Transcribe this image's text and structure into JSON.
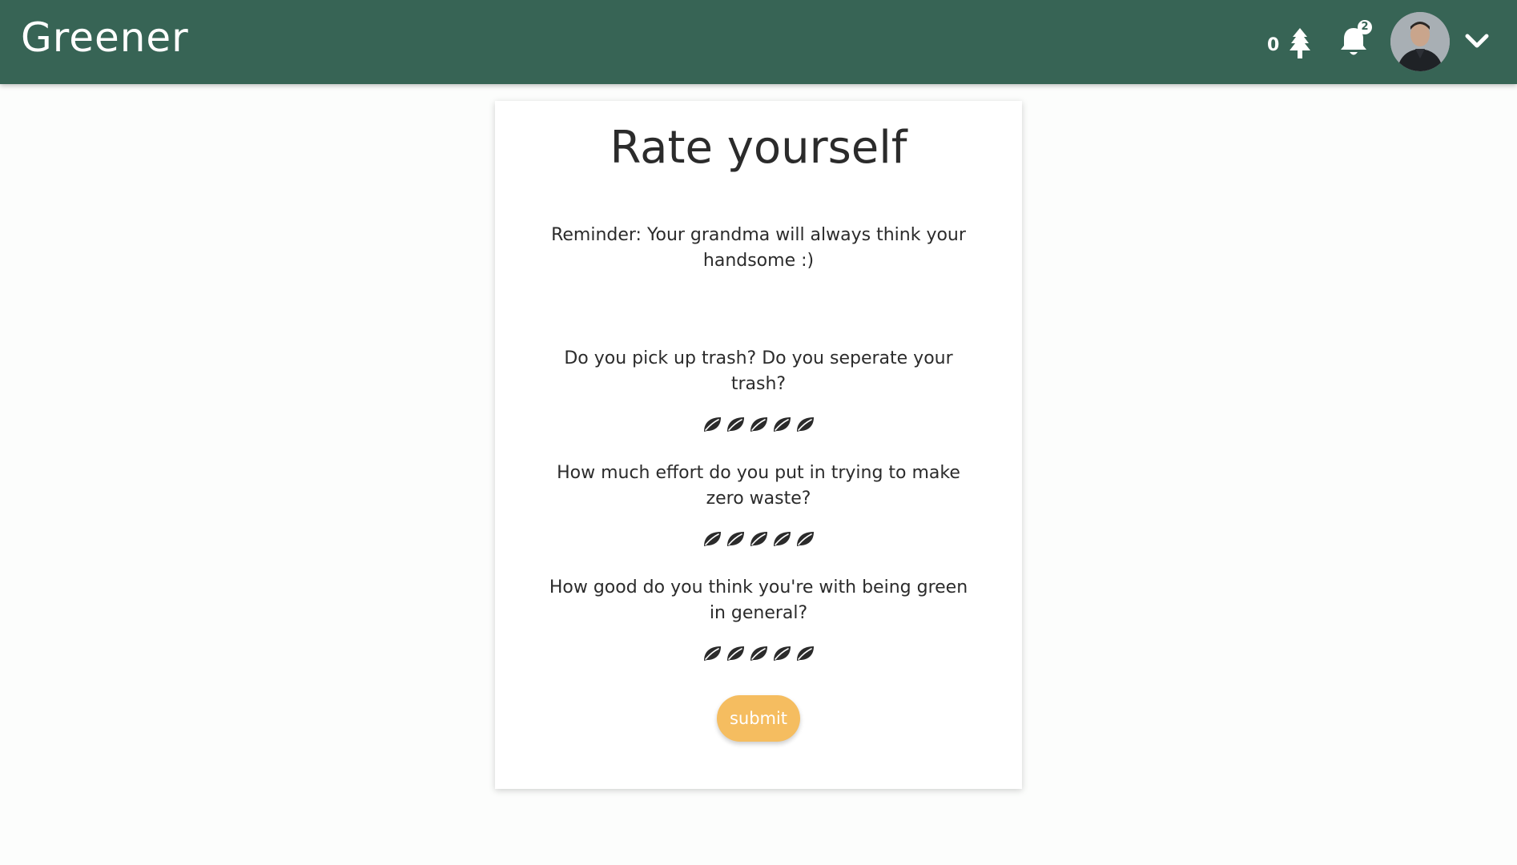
{
  "header": {
    "brand": "Greener",
    "tree_count": "0",
    "notification_count": "2",
    "colors": {
      "bar": "#376455",
      "text": "#ffffff"
    }
  },
  "card": {
    "title": "Rate yourself",
    "reminder": "Reminder: Your grandma will always think your handsome :)",
    "questions": [
      {
        "text": "Do you pick up trash? Do you seperate your trash?",
        "rating_scale": 5,
        "rating_value": 0,
        "icon": "leaf-icon"
      },
      {
        "text": "How much effort do you put in trying to make zero waste?",
        "rating_scale": 5,
        "rating_value": 0,
        "icon": "leaf-icon"
      },
      {
        "text": "How good do you think you're with being green in general?",
        "rating_scale": 5,
        "rating_value": 0,
        "icon": "leaf-icon"
      }
    ],
    "submit_label": "submit",
    "submit_color": "#f5bd60"
  }
}
